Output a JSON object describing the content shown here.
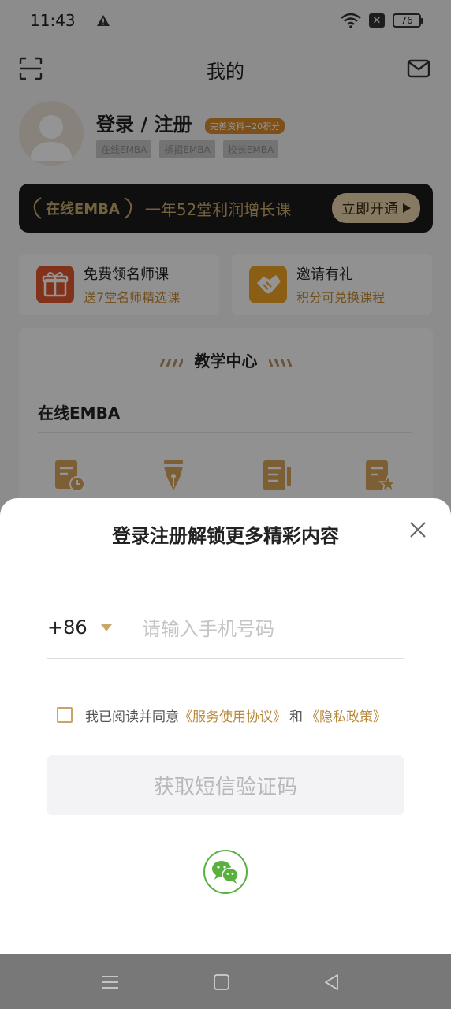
{
  "status_bar": {
    "time": "11:43",
    "battery": "76"
  },
  "header": {
    "title": "我的"
  },
  "profile": {
    "login_label": "登录 / 注册",
    "reward_badge": "完善资料+20积分",
    "tags": [
      "在线EMBA",
      "拆招EMBA",
      "校长EMBA"
    ]
  },
  "emba_banner": {
    "logo": "在线EMBA",
    "slogan": "一年52堂利润增长课",
    "button": "立即开通"
  },
  "promos": [
    {
      "title": "免费领名师课",
      "subtitle": "送7堂名师精选课",
      "icon": "gift-icon",
      "color": "#e0572e"
    },
    {
      "title": "邀请有礼",
      "subtitle": "积分可兑换课程",
      "icon": "handshake-icon",
      "color": "#f0a325"
    }
  ],
  "teaching": {
    "heading": "教学中心",
    "section": "在线EMBA"
  },
  "sheet": {
    "title": "登录注册解锁更多精彩内容",
    "country_code": "+86",
    "phone_placeholder": "请输入手机号码",
    "agree_prefix": "我已阅读并同意",
    "terms_link": "《服务使用协议》",
    "and": "和",
    "privacy_link": "《隐私政策》",
    "sms_button": "获取短信验证码"
  },
  "colors": {
    "accent_gold": "#c9a86a",
    "wechat_green": "#59b13d",
    "promo_orange": "#c58a35"
  }
}
